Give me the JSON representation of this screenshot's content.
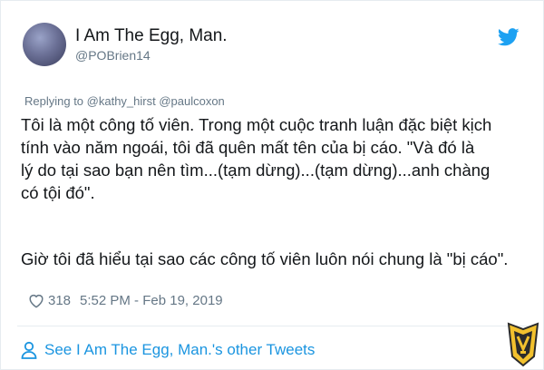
{
  "author": {
    "display_name": "I Am The Egg, Man.",
    "handle": "@POBrien14"
  },
  "reply": {
    "text": "Replying to @kathy_hirst @paulcoxon"
  },
  "tweet": {
    "paragraph1": "Tôi là một công tố viên. Trong một cuộc tranh luận đặc biệt kịch\ntính vào năm ngoái, tôi đã quên mất  tên của bị cáo. \"Và đó là\nlý do tại sao bạn nên tìm...(tạm dừng)...(tạm dừng)...anh chàng\ncó tội đó\".",
    "paragraph2": "Giờ tôi đã hiểu tại sao các công tố viên luôn nói chung là \"bị cáo\"."
  },
  "meta": {
    "likes": "318",
    "timestamp": "5:52 PM - Feb 19, 2019"
  },
  "footer": {
    "see_more": "See I Am The Egg, Man.'s other Tweets"
  },
  "icons": {
    "brand": "twitter-bird-icon",
    "like": "heart-icon",
    "profile": "person-icon",
    "watermark": "logo-watermark"
  },
  "colors": {
    "accent": "#1b95e0",
    "secondary_text": "#657786",
    "primary_text": "#14171a"
  }
}
